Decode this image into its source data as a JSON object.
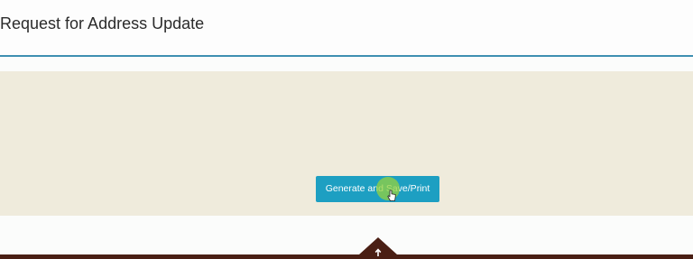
{
  "header": {
    "title": "Request for Address Update"
  },
  "actions": {
    "generate_label": "Generate and Save/Print"
  },
  "colors": {
    "accent": "#1d9fc2",
    "title_rule": "#3f8fb2",
    "panel_background": "#efebdc",
    "footer": "#4a1f14"
  },
  "icons": {
    "scroll_top": "arrow-up-icon",
    "cursor": "hand-pointer-icon"
  }
}
